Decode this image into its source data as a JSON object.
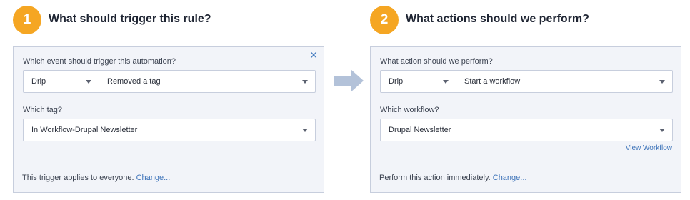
{
  "step1": {
    "number": "1",
    "title": "What should trigger this rule?",
    "close_icon": "close-icon",
    "event_label": "Which event should trigger this automation?",
    "event_provider": "Drip",
    "event_type": "Removed a tag",
    "tag_label": "Which tag?",
    "tag_value": "In Workflow-Drupal Newsletter",
    "footer_text": "This trigger applies to everyone.",
    "footer_link": "Change..."
  },
  "step2": {
    "number": "2",
    "title": "What actions should we perform?",
    "action_label": "What action should we perform?",
    "action_provider": "Drip",
    "action_type": "Start a workflow",
    "workflow_label": "Which workflow?",
    "workflow_value": "Drupal Newsletter",
    "view_link": "View Workflow",
    "footer_text": "Perform this action immediately.",
    "footer_link": "Change..."
  },
  "colors": {
    "badge": "#f5a623",
    "panel_bg": "#f2f4f9",
    "link": "#3d73b9",
    "arrow": "#b3c2d9"
  },
  "icons": {
    "dropdown": "chevron-down-icon",
    "flow": "arrow-right-icon"
  }
}
